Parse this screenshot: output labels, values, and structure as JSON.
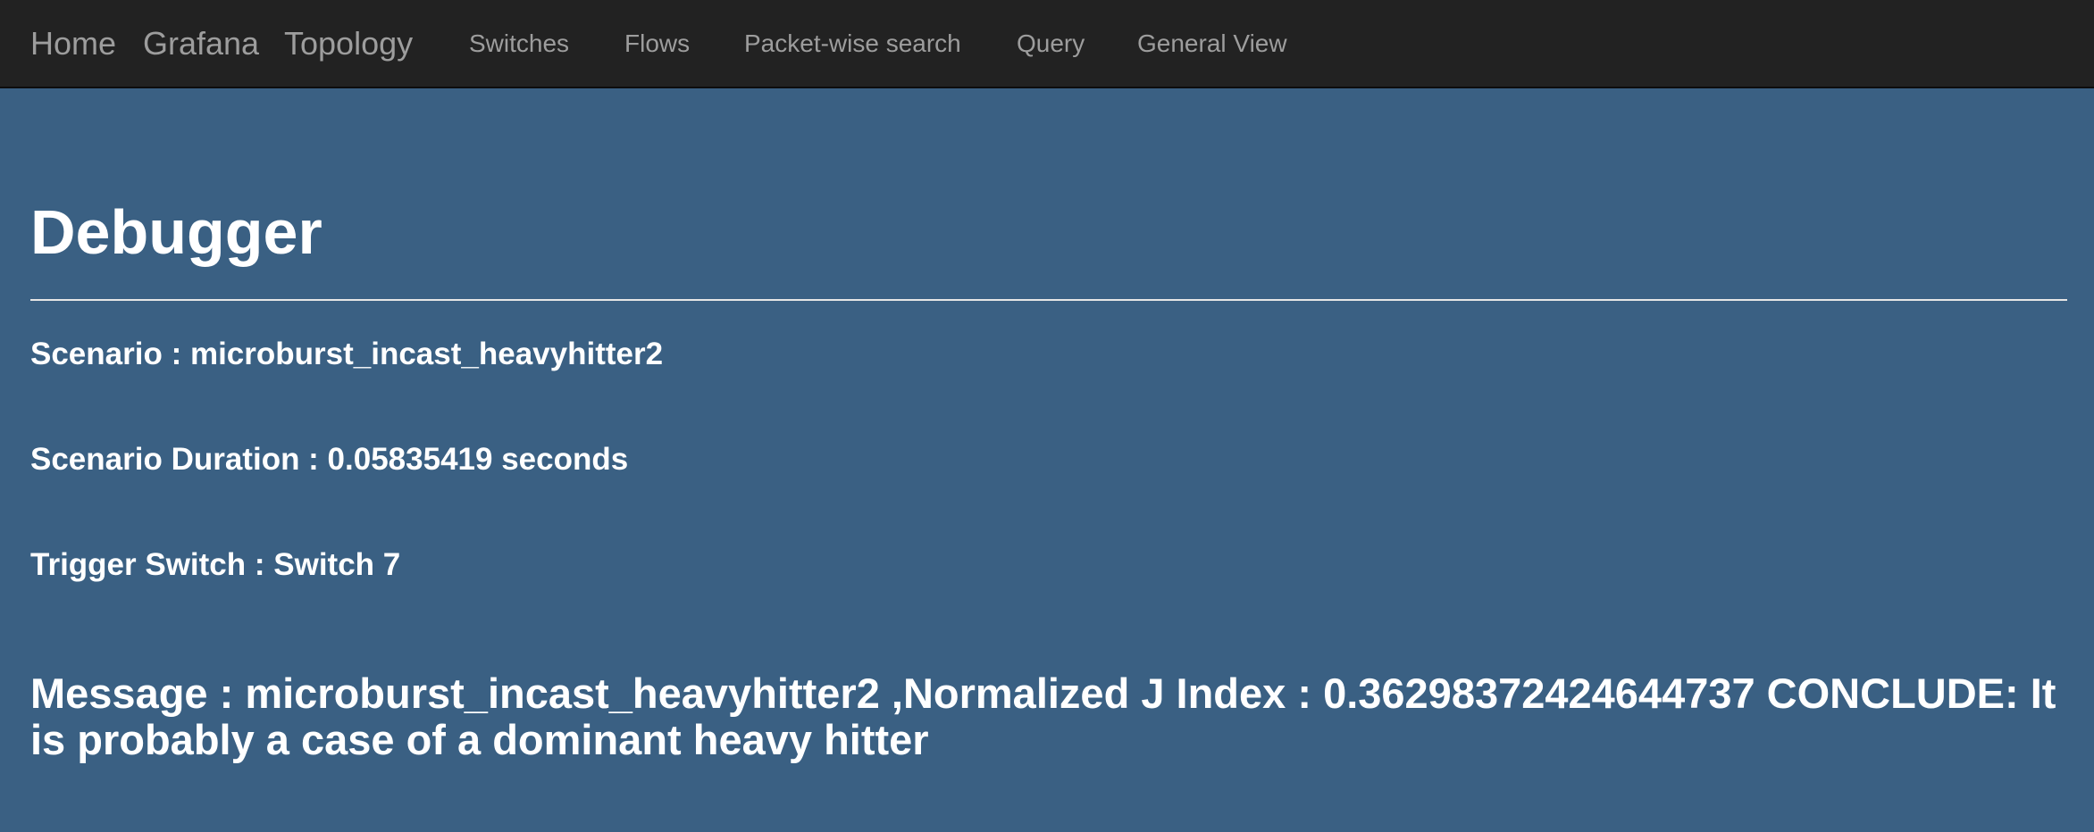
{
  "navbar": {
    "brand_links": [
      "Home",
      "Grafana",
      "Topology"
    ],
    "items": [
      "Switches",
      "Flows",
      "Packet-wise search",
      "Query",
      "General View"
    ]
  },
  "page": {
    "title": "Debugger"
  },
  "scenario": {
    "name_label": "Scenario : microburst_incast_heavyhitter2",
    "duration_label": "Scenario Duration : 0.05835419 seconds",
    "trigger_label": "Trigger Switch : Switch 7",
    "message_label": "Message : microburst_incast_heavyhitter2 ,Normalized J Index : 0.36298372424644737 CONCLUDE: It is probably a case of a dominant heavy hitter"
  },
  "colors": {
    "navbar_bg": "#222222",
    "nav_text": "#9d9d9d",
    "page_bg": "#3a6083",
    "content_text": "#ffffff"
  }
}
